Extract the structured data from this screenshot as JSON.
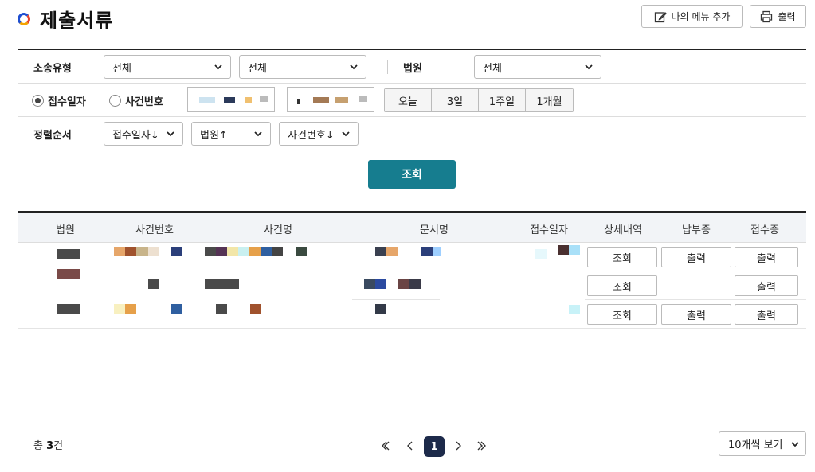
{
  "header": {
    "title": "제출서류",
    "my_menu_label": "나의 메뉴 추가",
    "print_label": "출력"
  },
  "filters": {
    "case_type_label": "소송유형",
    "case_type_value_1": "전체",
    "case_type_value_2": "전체",
    "court_label": "법원",
    "court_value": "전체",
    "radio_receipt_date": "접수일자",
    "radio_case_number": "사건번호",
    "quick_ranges": [
      "오늘",
      "3일",
      "1주일",
      "1개월"
    ],
    "sort_label": "정렬순서",
    "sort_1": "접수일자↓",
    "sort_2": "법원↑",
    "sort_3": "사건번호↓"
  },
  "search_button_label": "조회",
  "table": {
    "columns": [
      "법원",
      "사건번호",
      "사건명",
      "문서명",
      "접수일자",
      "상세내역",
      "납부증",
      "접수증"
    ],
    "rows": [
      {
        "detail": "조회",
        "payment": "출력",
        "receipt": "출력"
      },
      {
        "detail": "조회",
        "payment": "",
        "receipt": "출력"
      },
      {
        "detail": "조회",
        "payment": "출력",
        "receipt": "출력"
      }
    ]
  },
  "footer": {
    "total_prefix": "총 ",
    "total_count": "3",
    "total_suffix": "건",
    "current_page": "1",
    "page_size": "10개씩 보기"
  },
  "colors": {
    "accent": "#167d8f",
    "page_active": "#1d2a4a"
  }
}
